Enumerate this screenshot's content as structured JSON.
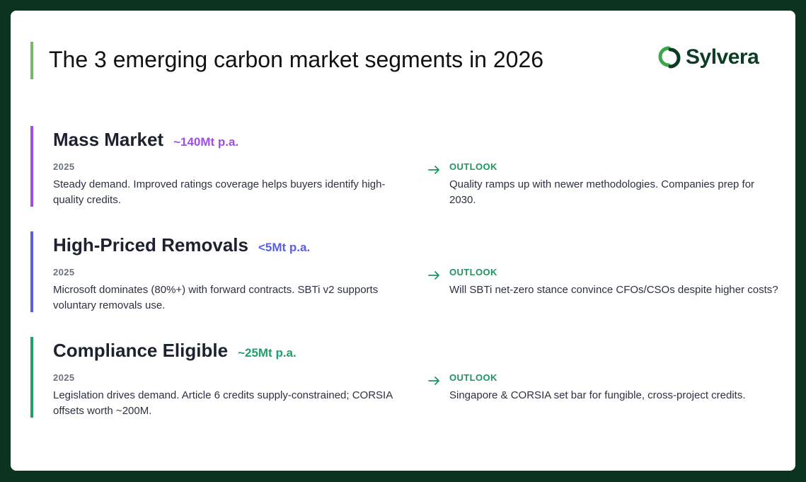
{
  "header": {
    "title": "The 3 emerging carbon market segments in 2026",
    "logo_text": "Sylvera"
  },
  "colors": {
    "background": "#0c3320",
    "title_accent": "#7bb56a",
    "outlook_label": "#1f9460"
  },
  "segments": [
    {
      "name": "Mass Market",
      "volume": "~140Mt p.a.",
      "accent": "#a24ee6",
      "left_label": "2025",
      "left_text": "Steady demand. Improved ratings coverage helps buyers identify high-quality credits.",
      "right_label": "OUTLOOK",
      "right_text": "Quality ramps up with newer methodologies. Companies prep for 2030."
    },
    {
      "name": "High-Priced Removals",
      "volume": "<5Mt p.a.",
      "accent": "#5b5fe0",
      "left_label": "2025",
      "left_text": "Microsoft dominates (80%+) with forward contracts. SBTi v2 supports voluntary removals use.",
      "right_label": "OUTLOOK",
      "right_text": "Will SBTi net-zero stance convince CFOs/CSOs despite higher costs?"
    },
    {
      "name": "Compliance Eligible",
      "volume": "~25Mt p.a.",
      "accent": "#22a06b",
      "left_label": "2025",
      "left_text": "Legislation drives demand. Article 6 credits supply-constrained; CORSIA offsets worth ~200M.",
      "right_label": "OUTLOOK",
      "right_text": "Singapore & CORSIA set bar for fungible, cross-project credits."
    }
  ]
}
